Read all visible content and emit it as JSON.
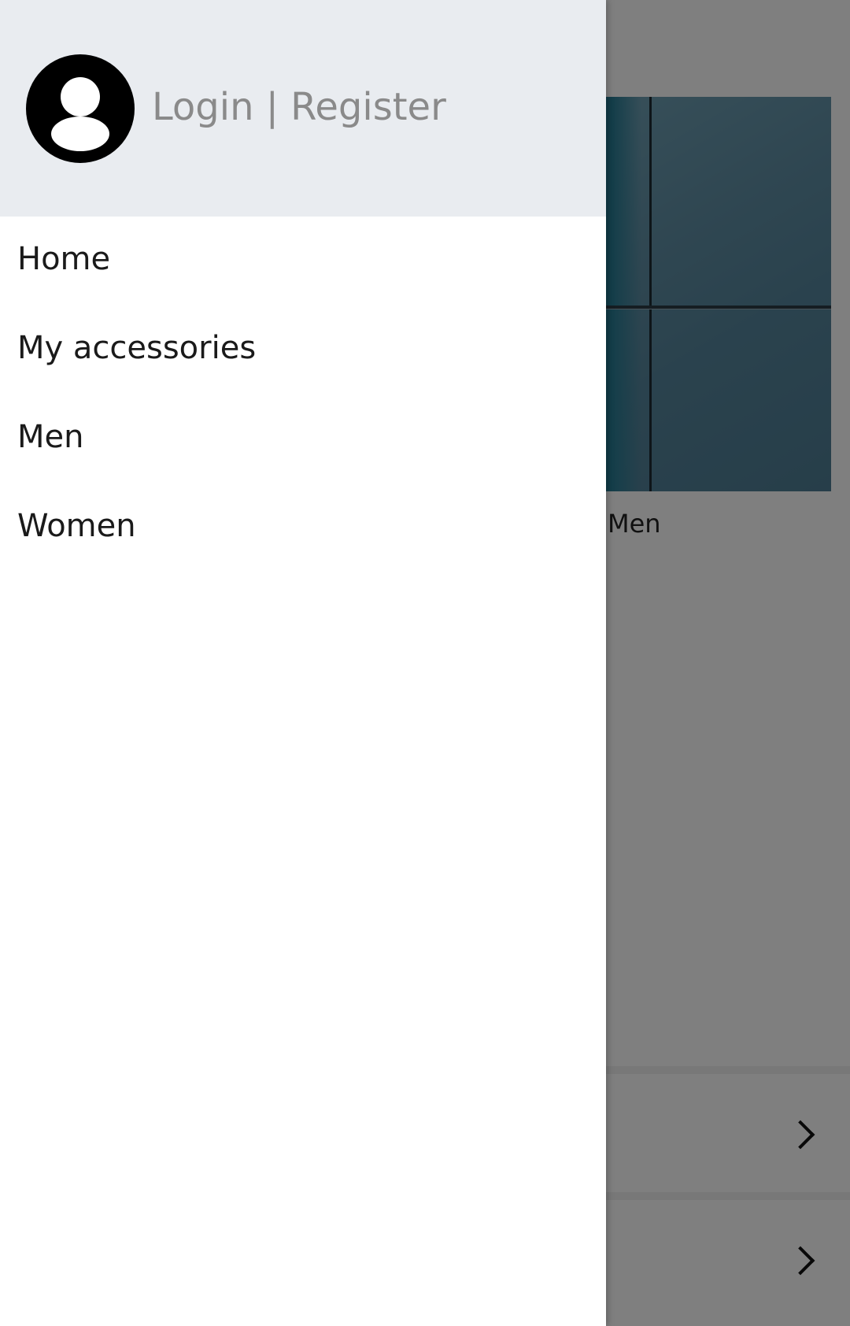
{
  "drawer": {
    "header": {
      "auth_label": "Login | Register"
    },
    "menu": [
      {
        "label": "Home"
      },
      {
        "label": "My accessories"
      },
      {
        "label": "Men"
      },
      {
        "label": "Women"
      }
    ]
  },
  "background": {
    "category_caption": "Men"
  },
  "icons": {
    "avatar": "account-circle-icon",
    "row_chevron": "chevron-right-icon"
  }
}
